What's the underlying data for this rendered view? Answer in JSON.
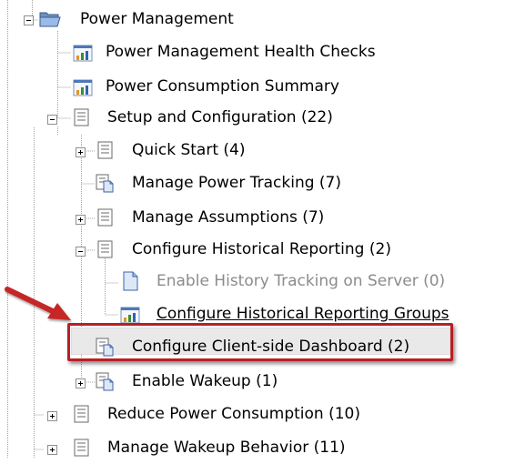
{
  "tree": {
    "items": [
      {
        "label": "Power Management",
        "icon": "folder-open-icon",
        "expander": "expanded"
      },
      {
        "label": "Power Management Health Checks",
        "icon": "report-chart-icon",
        "expander": "none"
      },
      {
        "label": "Power Consumption Summary",
        "icon": "report-chart-icon",
        "expander": "none"
      },
      {
        "label": "Setup and Configuration (22)",
        "icon": "list-icon",
        "expander": "expanded"
      },
      {
        "label": "Quick Start (4)",
        "icon": "list-icon",
        "expander": "collapsed"
      },
      {
        "label": "Manage Power Tracking (7)",
        "icon": "list-doc-icon",
        "expander": "none"
      },
      {
        "label": "Manage Assumptions (7)",
        "icon": "list-icon",
        "expander": "collapsed"
      },
      {
        "label": "Configure Historical Reporting (2)",
        "icon": "list-icon",
        "expander": "expanded"
      },
      {
        "label": "Enable History Tracking on Server (0)",
        "icon": "document-icon",
        "expander": "none"
      },
      {
        "label": "Configure Historical Reporting Groups",
        "icon": "report-chart-icon",
        "expander": "none"
      },
      {
        "label": "Configure Client-side Dashboard (2)",
        "icon": "list-doc-icon",
        "expander": "none"
      },
      {
        "label": "Enable Wakeup (1)",
        "icon": "list-doc-icon",
        "expander": "collapsed"
      },
      {
        "label": "Reduce Power Consumption (10)",
        "icon": "list-icon",
        "expander": "collapsed"
      },
      {
        "label": "Manage Wakeup Behavior (11)",
        "icon": "list-icon",
        "expander": "collapsed"
      }
    ]
  },
  "annotation": {
    "highlight_color": "#b81f24",
    "arrow_color": "#c62828"
  },
  "colors": {
    "disabled_text": "#8b8b8b",
    "selection_bg": "#e9e9e9"
  }
}
